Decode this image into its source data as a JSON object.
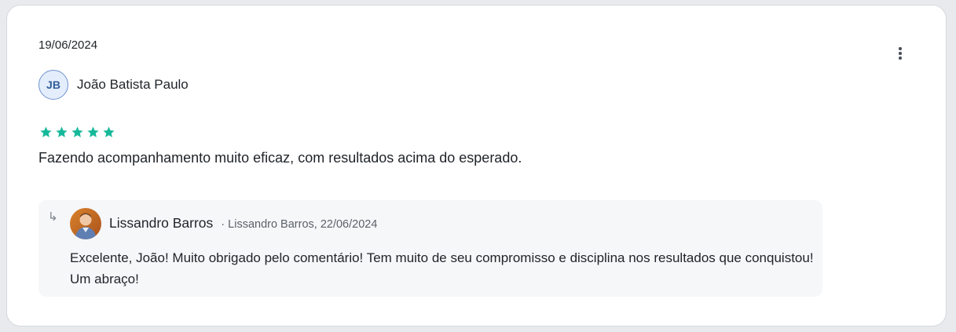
{
  "review": {
    "date": "19/06/2024",
    "author": {
      "initials": "JB",
      "name": "João Batista Paulo"
    },
    "rating": 5,
    "rating_max": 5,
    "star_color": "#16b89a",
    "text": "Fazendo acompanhamento muito eficaz, com resultados acima do esperado.",
    "menu_icon": "more-vertical-icon"
  },
  "reply": {
    "arrow_icon": "reply-arrow-icon",
    "author_name": "Lissandro Barros",
    "meta": "· Lissandro Barros, 22/06/2024",
    "text": "Excelente, João! Muito obrigado pelo comentário! Tem muito de seu compromisso e disciplina nos resultados que conquistou! Um abraço!"
  }
}
